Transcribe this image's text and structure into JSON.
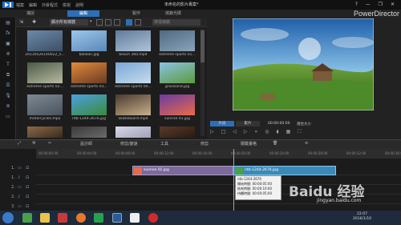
{
  "menu": {
    "items": [
      "檔案",
      "編輯",
      "外掛程式",
      "檢視",
      "說明"
    ]
  },
  "document_title": "未命名的影片專案*",
  "window_controls": "? — ❐ ✕",
  "tabs": [
    "捕捉",
    "編輯",
    "製作",
    "燒錄光碟"
  ],
  "brand": "PowerDirector",
  "left_tools": [
    "media-icon",
    "fx-icon",
    "pip-icon",
    "particle-icon",
    "title-icon",
    "transition-icon",
    "audio-mix-icon",
    "voice-icon",
    "chapter-icon",
    "subtitle-icon"
  ],
  "library": {
    "filter": "顯示所有媒體",
    "search_placeholder": "搜尋媒體",
    "items": [
      {
        "label": "20130526140022_5...",
        "colors": [
          "#6e8aa8",
          "#3b4f65"
        ]
      },
      {
        "label": "balloon.jpg",
        "colors": [
          "#9cc6ea",
          "#5c88b8"
        ]
      },
      {
        "label": "beach 360.mp4",
        "colors": [
          "#5f7b9a",
          "#b0c4d8"
        ]
      },
      {
        "label": "extreme sports 01...",
        "colors": [
          "#4e6a82",
          "#8aa3b8"
        ]
      },
      {
        "label": "extreme sports 02...",
        "colors": [
          "#4a5a46",
          "#b9b9a2"
        ]
      },
      {
        "label": "extreme sports 03...",
        "colors": [
          "#e28a3c",
          "#6a3c22"
        ]
      },
      {
        "label": "extreme sports 04...",
        "colors": [
          "#7aa6d6",
          "#c6dcee"
        ]
      },
      {
        "label": "grassland.jpg",
        "colors": [
          "#8bc3e4",
          "#5c9a3c"
        ]
      },
      {
        "label": "motorcycles.mpo",
        "colors": [
          "#7d8a96",
          "#4a525c"
        ]
      },
      {
        "label": "ntb-1244-2676.jpg",
        "colors": [
          "#4ca0e0",
          "#3a8a3a"
        ]
      },
      {
        "label": "Skateboard.mp4",
        "colors": [
          "#4a3a30",
          "#c8b08a"
        ]
      },
      {
        "label": "sunrise 01.jpg",
        "colors": [
          "#6a3ca0",
          "#e86a4a"
        ]
      },
      {
        "label": "",
        "colors": [
          "#8a6a4a",
          "#3a2a1a"
        ]
      },
      {
        "label": "",
        "colors": [
          "#3a3a3a",
          "#6a6a6a"
        ]
      },
      {
        "label": "",
        "colors": [
          "#d8d8e8",
          "#a0a0b8"
        ]
      },
      {
        "label": "",
        "colors": [
          "#5a3a2a",
          "#2a1a10"
        ]
      }
    ]
  },
  "preview": {
    "mode_clip": "片段",
    "mode_movie": "影片",
    "timecode": "00:00:00:00",
    "quality": "適合大小"
  },
  "timeline": {
    "tools": [
      "設計師",
      "修剪/變速",
      "工具",
      "修剪",
      "關鍵畫格"
    ],
    "ruler_ticks": [
      "00:00:00:00",
      "00:00:04:00",
      "00:00:08:00",
      "00:00:12:00",
      "00:00:16:00",
      "00:00:20:00",
      "00:00:24:00",
      "00:00:28:00",
      "00:00:32:00",
      "00:00:36:00"
    ],
    "tracks": [
      {
        "name": "1."
      },
      {
        "name": "1."
      },
      {
        "name": "2."
      },
      {
        "name": "2."
      },
      {
        "name": "3."
      }
    ],
    "clips": [
      {
        "label": "sunrise 01.jpg"
      },
      {
        "label": "ntb-1244-2676.jpg"
      }
    ],
    "tooltip": {
      "title": "ntb-1244-2676",
      "line1": "開始時間: 00:00:05:00",
      "line2": "結束時間: 00:00:10:00",
      "line3": "持續時間: 00:00:05:00"
    }
  },
  "taskbar": {
    "time": "22:07",
    "date": "2016/1/10"
  },
  "watermark": {
    "text": "Baidu 经验",
    "url": "jingyan.baidu.com"
  }
}
